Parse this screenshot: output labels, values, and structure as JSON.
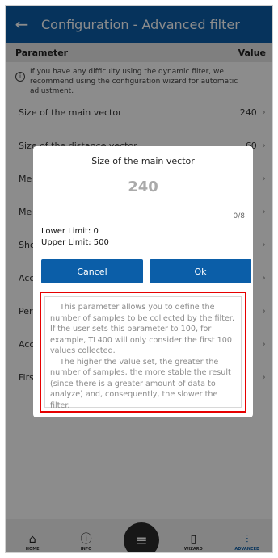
{
  "header": {
    "title": "Configuration - Advanced filter",
    "back_icon": "arrow-left-icon"
  },
  "columns": {
    "parameter": "Parameter",
    "value": "Value"
  },
  "info": {
    "text": "If you have any difficulty using the dynamic filter, we recommend using the configuration wizard for automatic adjustment."
  },
  "params": [
    {
      "label": "Size of the main vector",
      "value": "240"
    },
    {
      "label": "Size of the distance vector",
      "value": "60"
    },
    {
      "label": "Me",
      "value": ""
    },
    {
      "label": "Me",
      "value": ""
    },
    {
      "label": "Sho",
      "value": ""
    },
    {
      "label": "Acc",
      "value": ""
    },
    {
      "label": "Per",
      "value": ""
    },
    {
      "label": "Acc",
      "value": ""
    },
    {
      "label": "Firs",
      "value": ""
    }
  ],
  "dialog": {
    "title": "Size of the main vector",
    "value": "240",
    "counter": "0/8",
    "lower_limit": "Lower Limit: 0",
    "upper_limit": "Upper Limit: 500",
    "cancel_label": "Cancel",
    "ok_label": "Ok",
    "description_p1": "This parameter allows you to define the number of samples to be collected by the filter. If the user sets this parameter to 100, for example, TL400 will only consider the first 100 values collected.",
    "description_p2": "The higher the value set, the greater the number of samples, the more stable the result (since there is a greater amount of data to analyze) and, consequently, the slower the filter."
  },
  "nav": {
    "home": "HOME",
    "info": "INFO",
    "wizard": "WIZARD",
    "advanced": "ADVANCED"
  },
  "colors": {
    "primary": "#0b5ea8",
    "highlight": "#e60000"
  }
}
